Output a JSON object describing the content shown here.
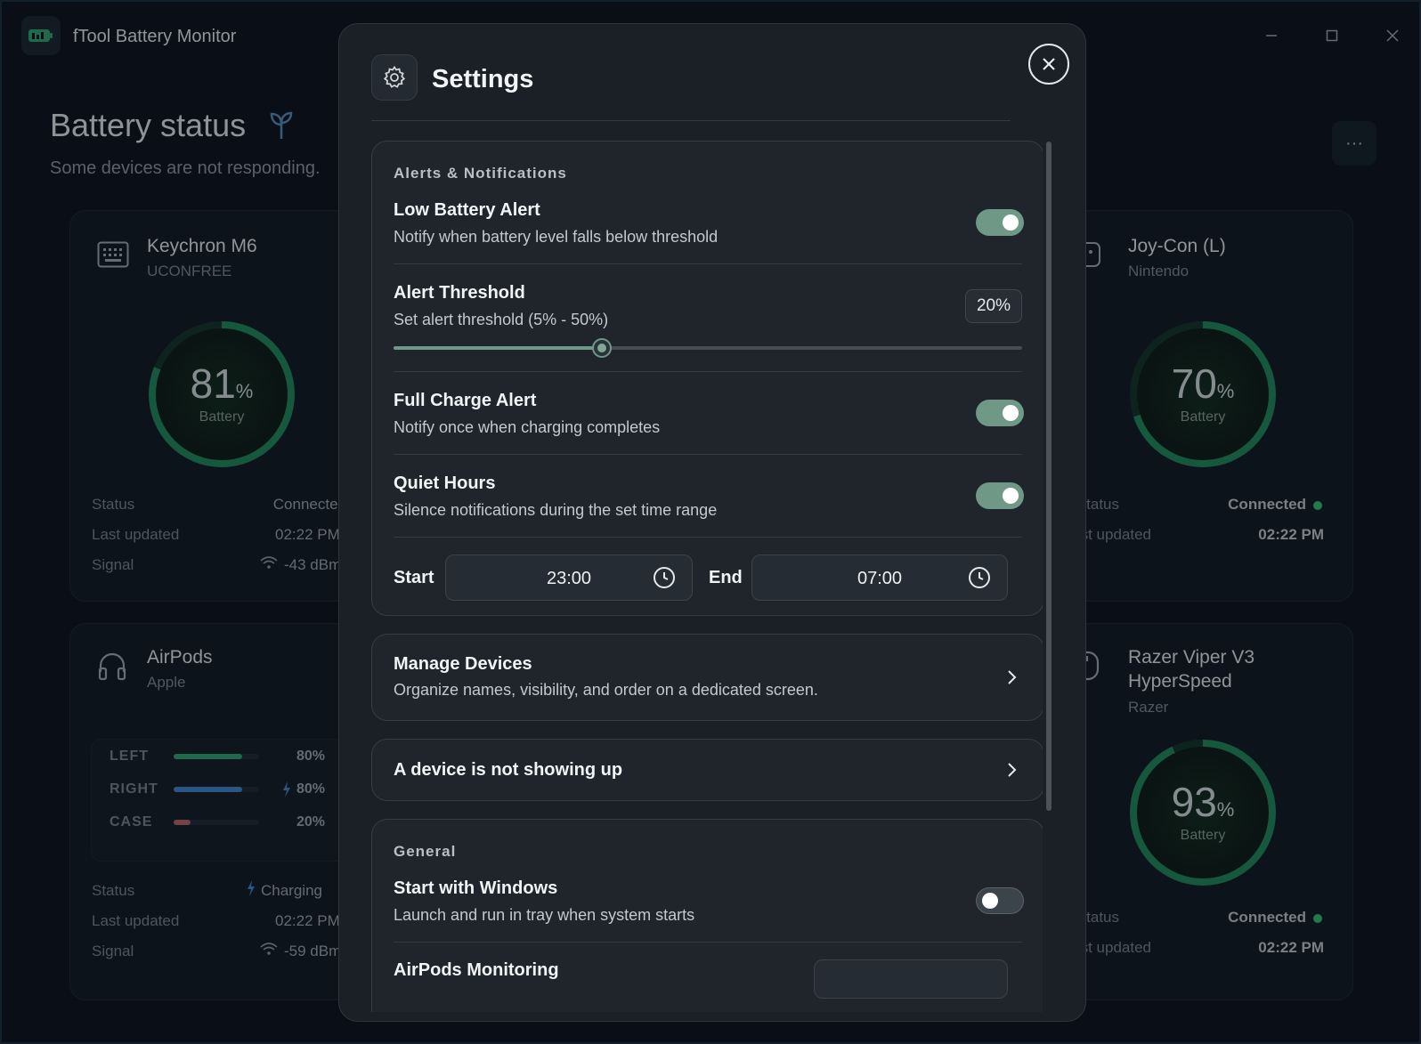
{
  "app": {
    "title": "fTool Battery Monitor",
    "window_controls": [
      "minimize",
      "maximize",
      "close"
    ]
  },
  "page": {
    "title": "Battery status",
    "subtitle": "Some devices are not responding.",
    "more_label": "···"
  },
  "devices": [
    {
      "name": "Keychron M6",
      "vendor": "UCONFREE",
      "icon": "keyboard-icon",
      "battery_pct": 81,
      "pct_unit": "%",
      "battery_label": "Battery",
      "status_label": "Status",
      "status": "Connected",
      "updated_label": "Last updated",
      "updated": "02:22 PM",
      "signal_label": "Signal",
      "signal": "-43 dBm"
    },
    {
      "name": "Joy-Con (L)",
      "vendor": "Nintendo",
      "icon": "gamepad-icon",
      "battery_pct": 70,
      "pct_unit": "%",
      "battery_label": "Battery",
      "status_label": "Status",
      "status": "Connected",
      "updated_label": "Last updated",
      "updated": "02:22 PM"
    },
    {
      "name": "AirPods",
      "vendor": "Apple",
      "icon": "headphones-icon",
      "pods": [
        {
          "label": "LEFT",
          "value": "80%",
          "level": 0.8,
          "color": "#2a9468",
          "charging": false
        },
        {
          "label": "RIGHT",
          "value": "80%",
          "level": 0.8,
          "color": "#3c77b8",
          "charging": true
        },
        {
          "label": "CASE",
          "value": "20%",
          "level": 0.2,
          "color": "#a05a64",
          "charging": false
        }
      ],
      "status_label": "Status",
      "status": "Charging",
      "updated_label": "Last updated",
      "updated": "02:22 PM",
      "signal_label": "Signal",
      "signal": "-59 dBm"
    },
    {
      "name": "Razer Viper V3 HyperSpeed",
      "name_line1": "Razer Viper V3",
      "name_line2": "HyperSpeed",
      "vendor": "Razer",
      "icon": "mouse-icon",
      "battery_pct": 93,
      "pct_unit": "%",
      "battery_label": "Battery",
      "status_label": "Status",
      "status": "Connected",
      "updated_label": "Last updated",
      "updated": "02:22 PM"
    }
  ],
  "settings": {
    "title": "Settings",
    "alerts": {
      "heading": "Alerts & Notifications",
      "low_battery": {
        "title": "Low Battery Alert",
        "desc": "Notify when battery level falls below threshold",
        "enabled": true
      },
      "threshold": {
        "title": "Alert Threshold",
        "desc": "Set alert threshold (5% - 50%)",
        "value_label": "20%",
        "value": 20,
        "min": 5,
        "max": 50
      },
      "full_charge": {
        "title": "Full Charge Alert",
        "desc": "Notify once when charging completes",
        "enabled": true
      },
      "quiet_hours": {
        "title": "Quiet Hours",
        "desc": "Silence notifications during the set time range",
        "enabled": true
      },
      "start_label": "Start",
      "start_time": "23:00",
      "end_label": "End",
      "end_time": "07:00"
    },
    "manage_devices": {
      "title": "Manage Devices",
      "desc": "Organize names, visibility, and order on a dedicated screen."
    },
    "not_showing": {
      "title": "A device is not showing up"
    },
    "general": {
      "heading": "General",
      "start_with_windows": {
        "title": "Start with Windows",
        "desc": "Launch and run in tray when system starts",
        "enabled": false
      },
      "airpods_monitoring": {
        "title": "AirPods Monitoring"
      }
    }
  },
  "colors": {
    "accent": "#6f9887",
    "ring": "#1f7a55",
    "connected_dot": "#2ea86a",
    "right_pod": "#3c77b8",
    "case_pod": "#a05a64"
  }
}
